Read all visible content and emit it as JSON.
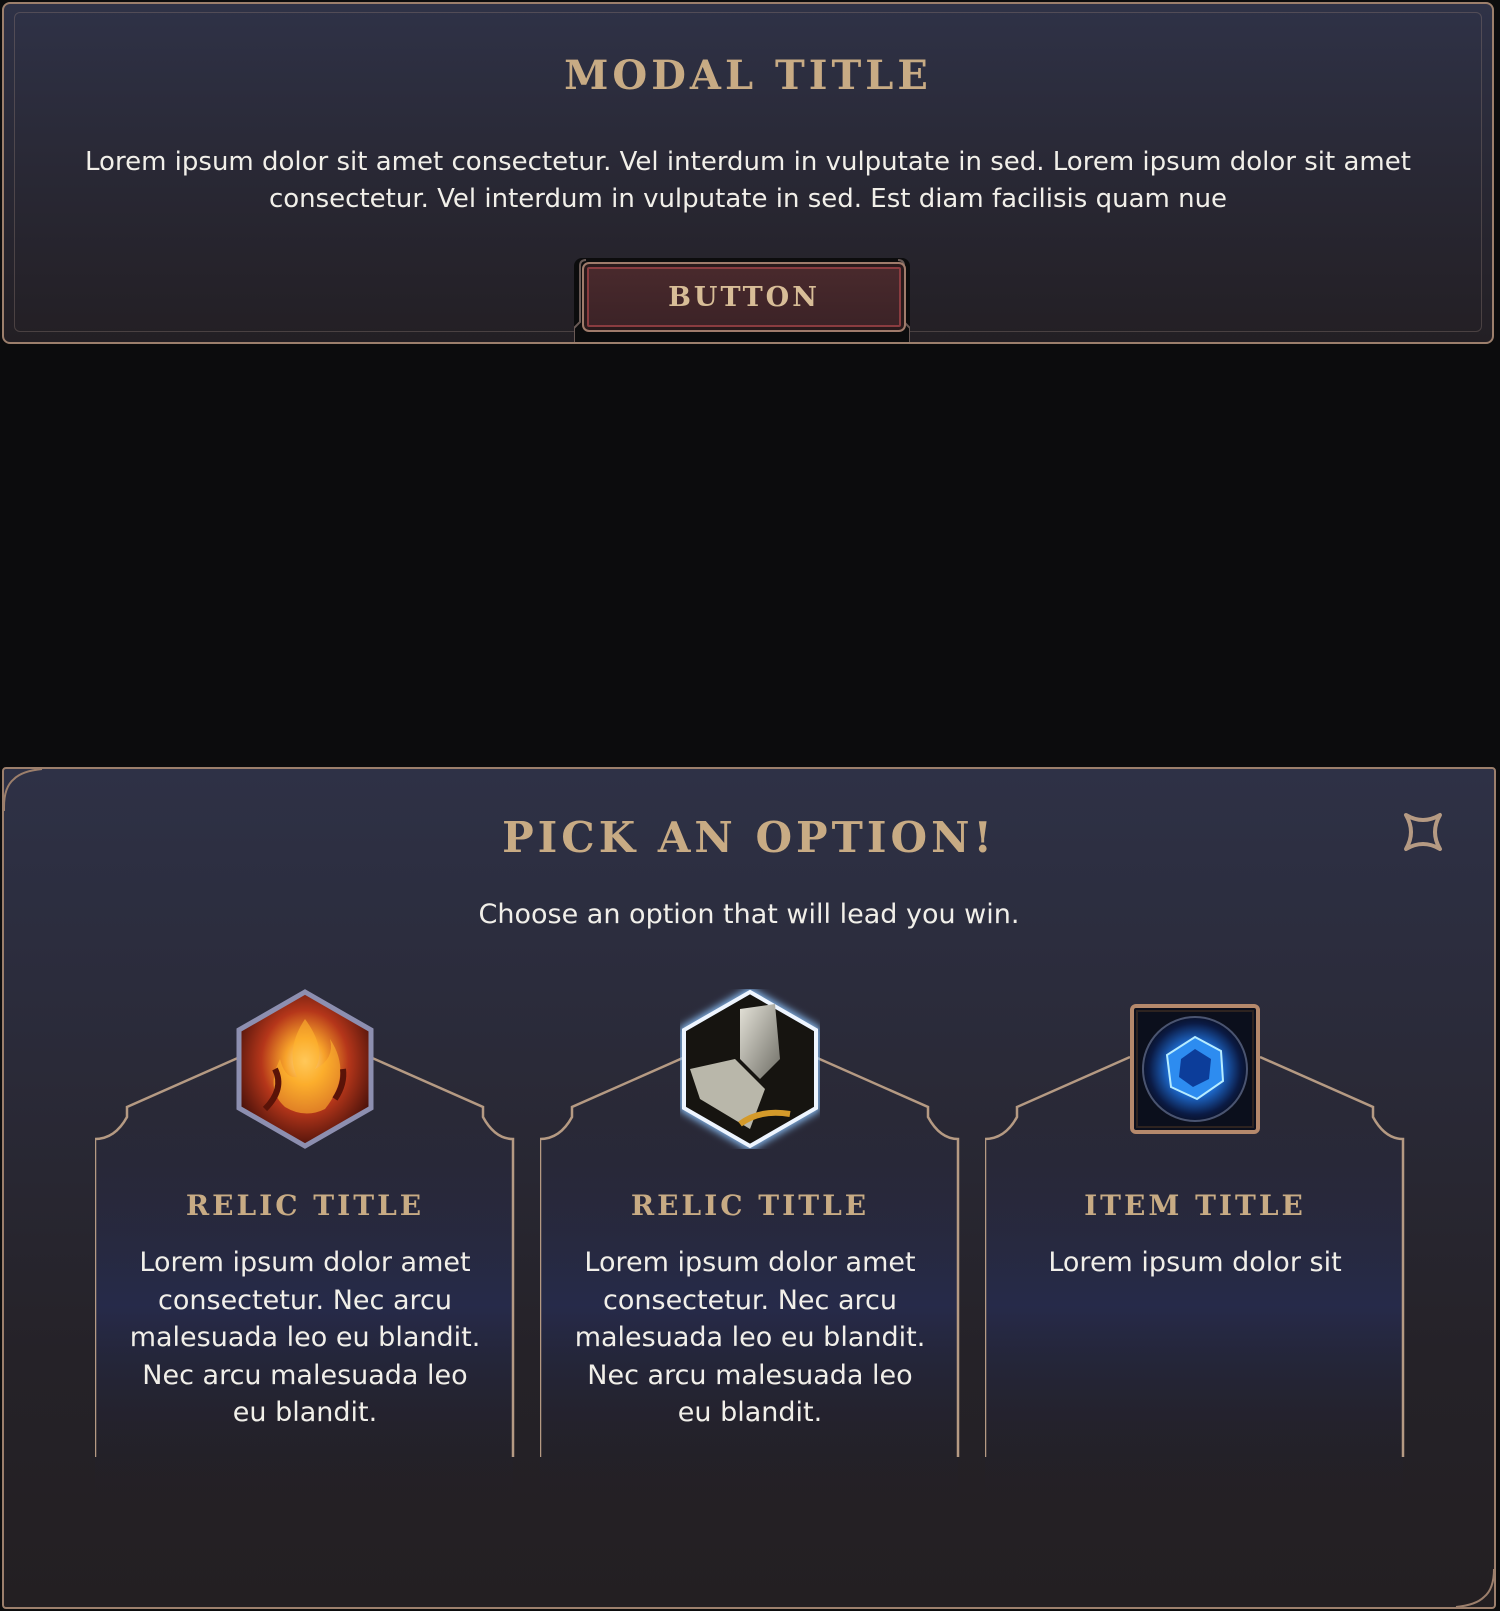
{
  "modal": {
    "title": "MODAL TITLE",
    "body": "Lorem ipsum dolor sit amet consectetur. Vel interdum in vulputate in sed. Lorem ipsum dolor sit amet consectetur. Vel interdum in vulputate in sed. Est diam facilisis quam nue",
    "button_label": "BUTTON"
  },
  "picker": {
    "title": "PICK AN OPTION!",
    "subtitle": "Choose an option that will lead you win.",
    "close_icon": "close-icon",
    "options": [
      {
        "title": "RELIC TITLE",
        "description": "Lorem ipsum dolor amet consectetur. Nec arcu malesuada leo eu blandit. Nec arcu malesuada leo eu blandit.",
        "icon": "fire-relic-icon",
        "frame": "hexagon",
        "frame_color": "#8d8fb0"
      },
      {
        "title": "RELIC TITLE",
        "description": "Lorem ipsum dolor amet consectetur. Nec arcu malesuada leo eu blandit. Nec arcu malesuada leo eu blandit.",
        "icon": "armor-relic-icon",
        "frame": "hexagon",
        "frame_color": "#e8f2ff"
      },
      {
        "title": "ITEM TITLE",
        "description": "Lorem ipsum dolor sit",
        "icon": "crystal-item-icon",
        "frame": "square",
        "frame_color": "#b5896c"
      }
    ]
  },
  "colors": {
    "accent_gold": "#c8ab84",
    "border": "#9c7f6c",
    "button_bg": "#4a2a2d",
    "page_bg": "#0c0c0d"
  }
}
